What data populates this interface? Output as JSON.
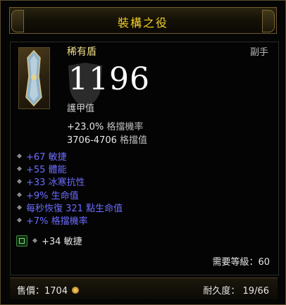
{
  "title": "裝構之役",
  "item": {
    "name": "稀有盾",
    "slot": "副手",
    "armor_value": "1196",
    "armor_label": "護甲值",
    "block_chance": {
      "value": "+23.0%",
      "label": "格擋機率"
    },
    "block_amount": {
      "value": "3706-4706",
      "label": "格擋值"
    }
  },
  "affixes": [
    "+67 敏捷",
    "+55 體能",
    "+33 冰寒抗性",
    "+9% 生命值",
    "每秒恢復 321 點生命值",
    "+7% 格擋機率"
  ],
  "socket": {
    "text": "+34 敏捷"
  },
  "required_level": "需要等級：60",
  "footer": {
    "price": "售價：1704",
    "durability": "耐久度：  19/66"
  },
  "colors": {
    "title": "#f4d02e",
    "item_name": "#f2e08a",
    "affix": "#6c6cff"
  }
}
